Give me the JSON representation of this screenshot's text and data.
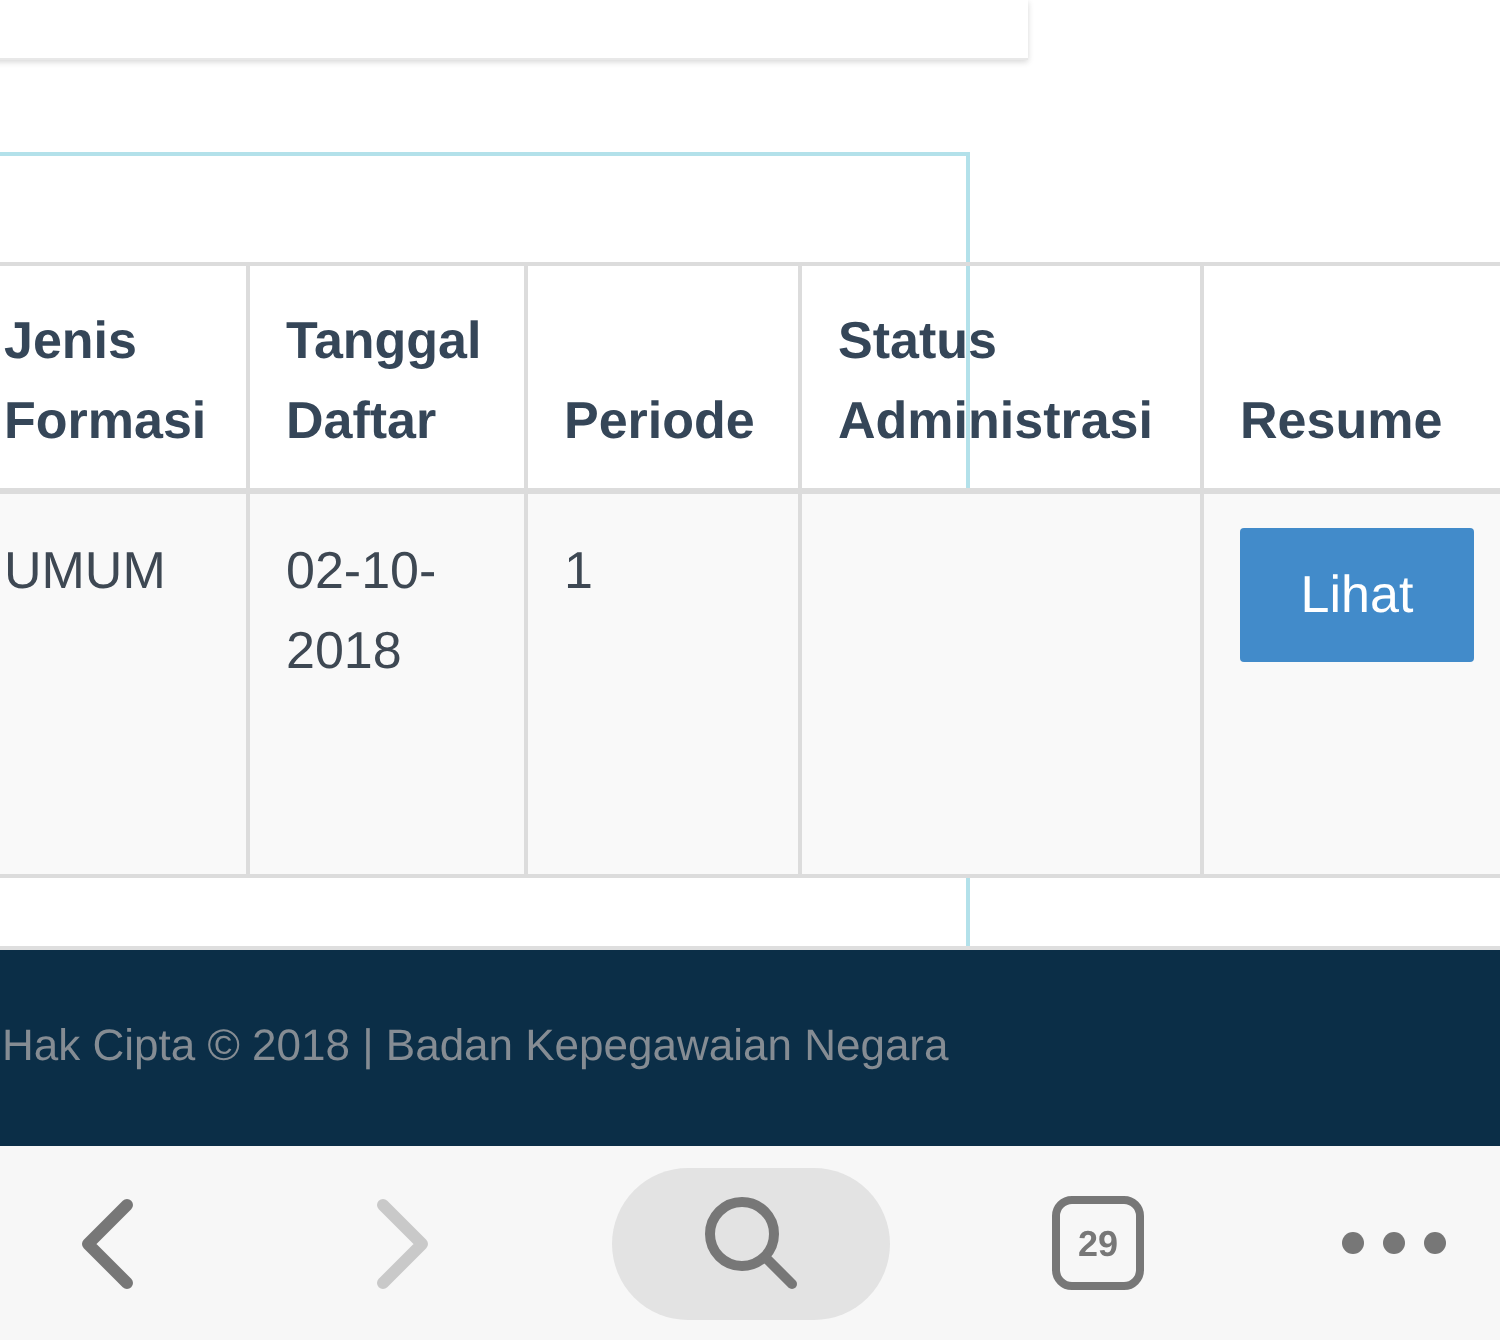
{
  "table": {
    "columns": [
      "Jenis Formasi",
      "Tanggal Daftar",
      "Periode",
      "Status Administrasi",
      "Resume"
    ],
    "rows": [
      {
        "jenis_formasi": "UMUM",
        "tanggal_daftar": "02-10-2018",
        "periode": "1",
        "resume_button": "Lihat"
      }
    ]
  },
  "footer": {
    "copyright": "Hak Cipta © 2018 | Badan Kepegawaian Negara"
  },
  "browser_toolbar": {
    "back": {
      "disabled": false
    },
    "forward": {
      "disabled": true
    },
    "tab_count": "29"
  }
}
